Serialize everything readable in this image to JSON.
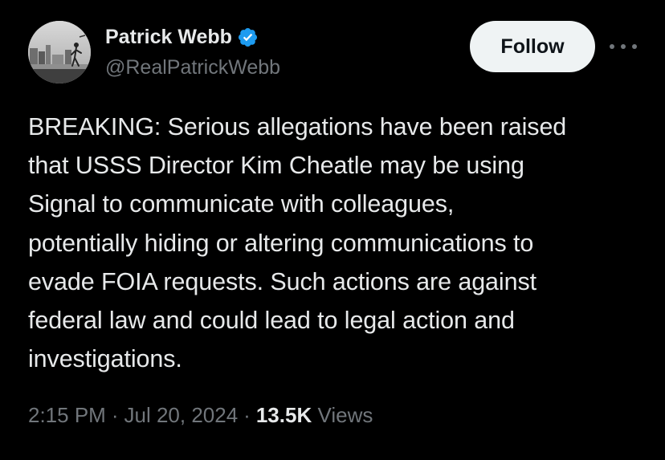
{
  "author": {
    "display_name": "Patrick Webb",
    "handle": "@RealPatrickWebb",
    "verified_icon": "verified-badge-icon",
    "verified_color": "#1d9bf0"
  },
  "actions": {
    "follow_label": "Follow",
    "more_icon": "more-options-icon"
  },
  "tweet": {
    "text": "BREAKING: Serious allegations have been raised\nthat USSS Director Kim Cheatle may be using\nSignal to communicate with colleagues,\npotentially hiding or altering communications to\nevade FOIA requests. Such actions are against\nfederal law and could lead to legal action and\ninvestigations."
  },
  "meta": {
    "time": "2:15 PM",
    "separator": "·",
    "date": "Jul 20, 2024",
    "views_count": "13.5K",
    "views_label": "Views"
  },
  "colors": {
    "background": "#000000",
    "primary_text": "#e7e9ea",
    "secondary_text": "#71767b",
    "follow_button_bg": "#eff3f4",
    "follow_button_text": "#0f1419"
  }
}
